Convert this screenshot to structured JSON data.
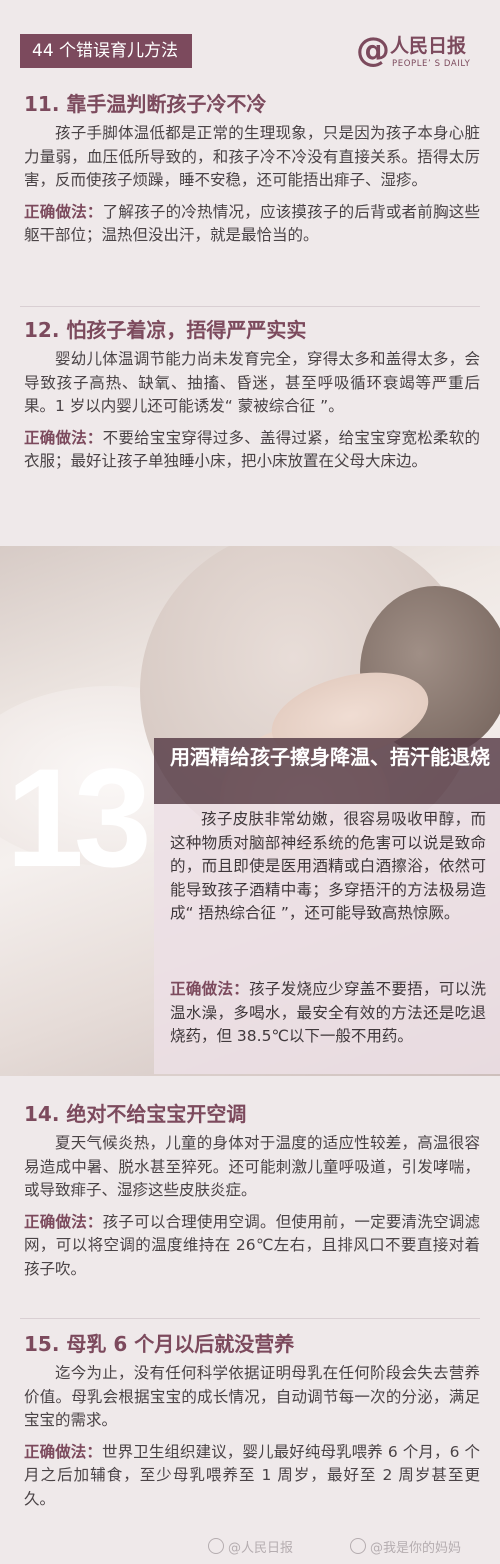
{
  "header": {
    "tab_label": "44 个错误育儿方法",
    "logo_cn": "人民日报",
    "logo_en": "PEOPLE’ S DAILY"
  },
  "correct_label": "正确做法：",
  "sections": [
    {
      "title": "11. 靠手温判断孩子冷不冷",
      "body": "孩子手脚体温低都是正常的生理现象，只是因为孩子本身心脏力量弱，血压低所导致的，和孩子冷不冷没有直接关系。捂得太厉害，反而使孩子烦躁，睡不安稳，还可能捂出痱子、湿疹。",
      "correct": "了解孩子的冷热情况，应该摸孩子的后背或者前胸这些躯干部位；温热但没出汗，就是最恰当的。"
    },
    {
      "title": "12. 怕孩子着凉，捂得严严实实",
      "body": "婴幼儿体温调节能力尚未发育完全，穿得太多和盖得太多，会导致孩子高热、缺氧、抽搐、昏迷，甚至呼吸循环衰竭等严重后果。1 岁以内婴儿还可能诱发“ 蒙被综合征 ”。",
      "correct": "不要给宝宝穿得过多、盖得过紧，给宝宝穿宽松柔软的衣服；最好让孩子单独睡小床，把小床放置在父母大床边。"
    },
    {
      "number": "13",
      "title": "用酒精给孩子擦身降温、捂汗能退烧",
      "body": "孩子皮肤非常幼嫩，很容易吸收甲醇，而这种物质对脑部神经系统的危害可以说是致命的，而且即使是医用酒精或白酒擦浴，依然可能导致孩子酒精中毒；多穿捂汗的方法极易造成“ 捂热综合征 ”，还可能导致高热惊厥。",
      "correct": "孩子发烧应少穿盖不要捂，可以洗温水澡，多喝水，最安全有效的方法还是吃退烧药，但 38.5℃以下一般不用药。"
    },
    {
      "title": "14. 绝对不给宝宝开空调",
      "body": "夏天气候炎热，儿童的身体对于温度的适应性较差，高温很容易造成中暑、脱水甚至猝死。还可能刺激儿童呼吸道，引发哮喘，或导致痱子、湿疹这些皮肤炎症。",
      "correct": "孩子可以合理使用空调。但使用前，一定要清洗空调滤网，可以将空调的温度维持在 26℃左右，且排风口不要直接对着孩子吹。"
    },
    {
      "title": "15. 母乳 6 个月以后就没营养",
      "body": "迄今为止，没有任何科学依据证明母乳在任何阶段会失去营养价值。母乳会根据宝宝的成长情况，自动调节每一次的分泌，满足宝宝的需求。",
      "correct": "世界卫生组织建议，婴儿最好纯母乳喂养 6 个月，6 个月之后加辅食，至少母乳喂养至 1 周岁，最好至 2 周岁甚至更久。"
    }
  ],
  "watermarks": [
    "@人民日报",
    "@我是你的妈妈"
  ]
}
